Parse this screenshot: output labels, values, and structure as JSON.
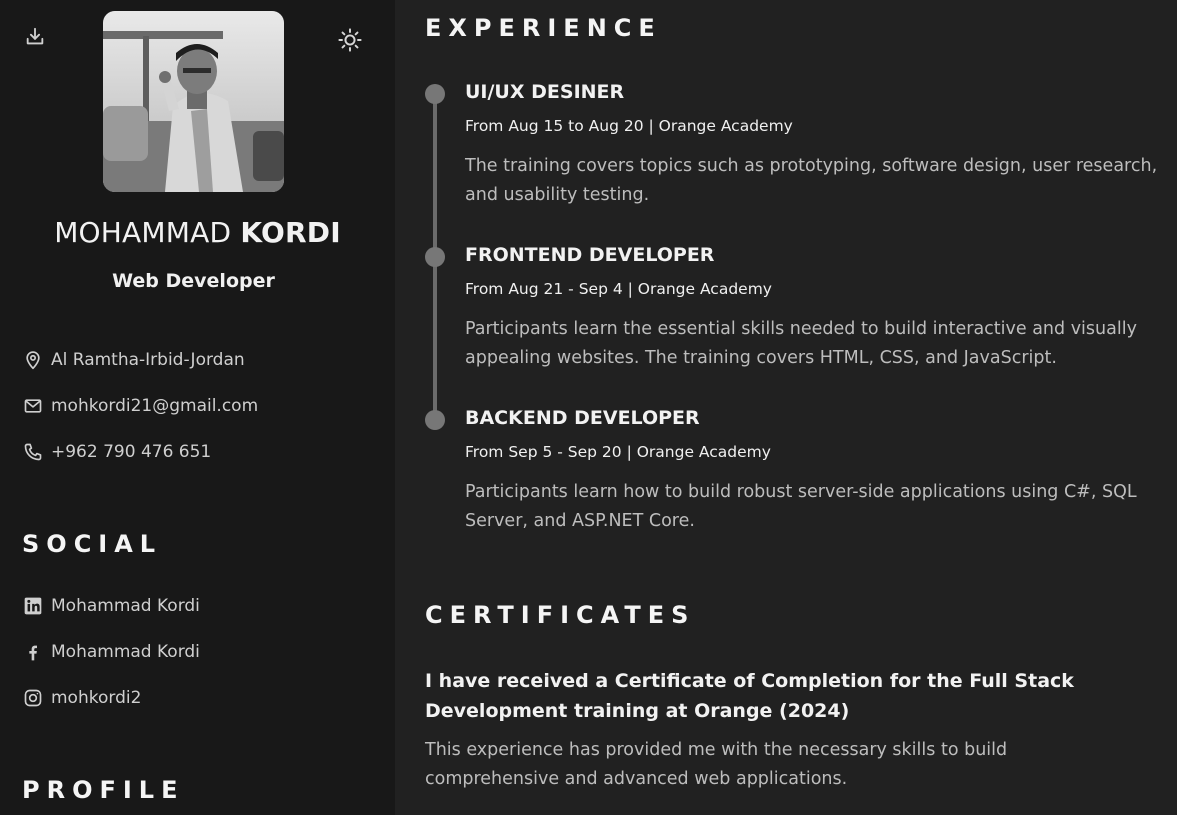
{
  "sidebar": {
    "download_icon": "download-icon",
    "theme_icon": "sun-icon",
    "name_first": "MOHAMMAD",
    "name_last": "KORDI",
    "job_title": "Web Developer",
    "contact": {
      "location": "Al Ramtha-Irbid-Jordan",
      "email": "mohkordi21@gmail.com",
      "phone": "+962 790 476 651"
    },
    "social_heading": "SOCIAL",
    "social": {
      "linkedin": "Mohammad Kordi",
      "facebook": "Mohammad Kordi",
      "instagram": "mohkordi2"
    },
    "profile_heading": "PROFILE"
  },
  "main": {
    "experience_heading": "EXPERIENCE",
    "experience": [
      {
        "title": "UI/UX DESINER",
        "meta": "From Aug 15 to Aug 20 | Orange Academy",
        "description": "The training covers topics such as prototyping, software design, user research, and usability testing."
      },
      {
        "title": "FRONTEND DEVELOPER",
        "meta": "From Aug 21 - Sep 4 | Orange Academy",
        "description": "Participants learn the essential skills needed to build interactive and visually appealing websites. The training covers HTML, CSS, and JavaScript."
      },
      {
        "title": "BACKEND DEVELOPER",
        "meta": "From Sep 5 - Sep 20 | Orange Academy",
        "description": "Participants learn how to build robust server-side applications using C#, SQL Server, and ASP.NET Core."
      }
    ],
    "certificates_heading": "CERTIFICATES",
    "certificate": {
      "title": "I have received a Certificate of Completion for the Full Stack Development training at Orange (2024)",
      "description": "This experience has provided me with the necessary skills to build comprehensive and advanced web applications."
    }
  },
  "colors": {
    "sidebar_bg": "#181818",
    "main_bg": "#212121",
    "timeline": "#6b6b6b"
  }
}
